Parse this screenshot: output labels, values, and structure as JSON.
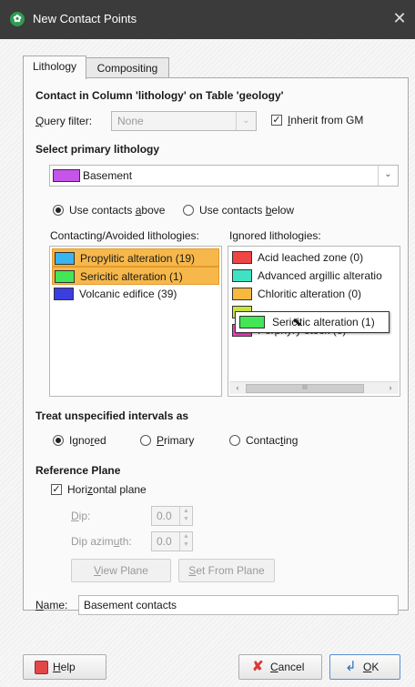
{
  "window": {
    "title": "New Contact Points",
    "app_icon": "geo-app-icon",
    "close_glyph": "✕"
  },
  "tabs": [
    {
      "label": "Lithology",
      "active": true
    },
    {
      "label": "Compositing",
      "active": false
    }
  ],
  "contact": {
    "heading": "Contact in Column 'lithology' on Table 'geology'",
    "query_filter": {
      "label": "Query filter:",
      "value": "None",
      "disabled": true
    },
    "inherit": {
      "label": "Inherit from GM",
      "checked": true
    }
  },
  "primary": {
    "heading": "Select primary lithology",
    "selected": {
      "label": "Basement",
      "color": "#c455e8"
    },
    "direction": {
      "above": {
        "label": "Use contacts above",
        "checked": true
      },
      "below": {
        "label": "Use contacts below",
        "checked": false
      }
    }
  },
  "lists": {
    "contacting_header": "Contacting/Avoided lithologies:",
    "ignored_header": "Ignored lithologies:",
    "contacting": [
      {
        "label": "Propylitic alteration (19)",
        "color": "#39b5ef",
        "selected": true
      },
      {
        "label": "Sericitic alteration (1)",
        "color": "#43e654",
        "selected": true
      },
      {
        "label": "Volcanic edifice (39)",
        "color": "#3a3ee0",
        "selected": false
      }
    ],
    "ignored": [
      {
        "label": "Acid leached zone (0)",
        "color": "#ef4545"
      },
      {
        "label": "Advanced argillic alteratio",
        "color": "#3fe3c4"
      },
      {
        "label": "Chloritic alteration (0)",
        "color": "#f7b93f"
      },
      {
        "label": "",
        "color": "#c7e63c"
      },
      {
        "label": "Porphyry stock (0)",
        "color": "#ef3fbf"
      }
    ],
    "scroll_thumb": "III",
    "drag_item": {
      "label": "Sericitic alteration (1)",
      "color": "#43e654"
    }
  },
  "unspecified": {
    "heading": "Treat unspecified intervals as",
    "options": [
      {
        "label": "Ignored",
        "checked": true
      },
      {
        "label": "Primary",
        "checked": false
      },
      {
        "label": "Contacting",
        "checked": false
      }
    ]
  },
  "plane": {
    "heading": "Reference Plane",
    "horizontal": {
      "label": "Horizontal plane",
      "checked": true
    },
    "dip": {
      "label": "Dip:",
      "value": "0.0"
    },
    "dip_azimuth": {
      "label": "Dip azimuth:",
      "value": "0.0"
    },
    "view_plane": "View Plane",
    "set_from_plane": "Set From Plane"
  },
  "name": {
    "label": "Name:",
    "value": "Basement contacts"
  },
  "buttons": {
    "help": "Help",
    "cancel": "Cancel",
    "ok": "OK"
  },
  "colors": {
    "titlebar": "#3b3b3b",
    "selection": "#f7b84b",
    "panel_border": "#a9a9a9"
  }
}
